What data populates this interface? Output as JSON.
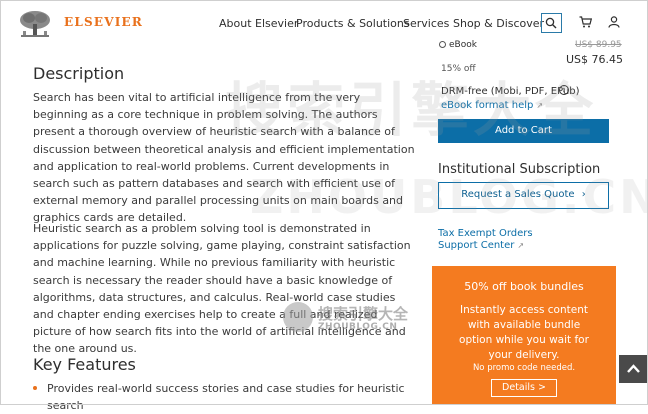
{
  "header": {
    "brand": "ELSEVIER",
    "nav": [
      "About Elsevier",
      "Products & Solutions",
      "Services",
      "Shop & Discover"
    ],
    "icons": [
      "search-icon",
      "cart-icon",
      "user-icon"
    ]
  },
  "main": {
    "description_title": "Description",
    "paragraphs": [
      "Search has been vital to artificial intelligence from the very beginning as a core technique in problem solving. The authors present a thorough overview of heuristic search with a balance of discussion between theoretical analysis and efficient implementation and application to real-world problems. Current developments in search such as pattern databases and search with efficient use of external memory and parallel processing units on main boards and graphics cards are detailed.",
      "Heuristic search as a problem solving tool is demonstrated in applications for puzzle solving, game playing, constraint satisfaction and machine learning. While no previous familiarity with heuristic search is necessary the reader should have a basic knowledge of algorithms, data structures, and calculus. Real-world case studies and chapter ending exercises help to create a full and realized picture of how search fits into the world of artificial intelligence and the one around us."
    ],
    "key_features_title": "Key Features",
    "key_features": [
      "Provides real-world success stories and case studies for heuristic search"
    ]
  },
  "sidebar": {
    "ebook_label": "eBook",
    "old_price": "US$ 89.95",
    "price": "US$ 76.45",
    "discount": "15% off",
    "drm": "DRM-free (Mobi, PDF, EPub)",
    "format_help": "eBook format help",
    "add_to_cart": "Add to Cart",
    "institutional_title": "Institutional Subscription",
    "sales_quote": "Request a Sales Quote",
    "tax_exempt": "Tax Exempt Orders",
    "support": "Support Center"
  },
  "promo": {
    "title": "50% off book bundles",
    "body": "Instantly access content with available bundle option while you wait for your delivery.",
    "note": "No promo code needed.",
    "button": "Details >"
  },
  "watermark": {
    "large": "搜索引擎大全",
    "latin": "ZHOUBLOG.CN",
    "small_cn": "搜索引擎大全",
    "small_url": "ZHOUBLOG.CN"
  },
  "colors": {
    "brand_orange": "#e9711c",
    "link_blue": "#0c6ea7",
    "promo_orange": "#f47b20",
    "button_blue": "#0c6ea7"
  }
}
